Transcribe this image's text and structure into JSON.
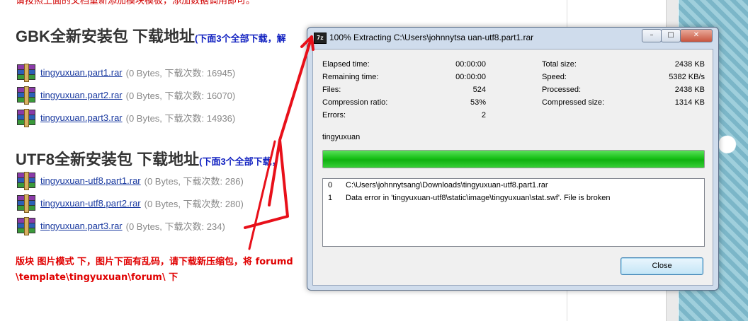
{
  "page": {
    "top_note": "请按照上面的文档重新添加模块模板，添加数据调用即可。",
    "gbk": {
      "title": "GBK全新安装包 下载地址",
      "sub": "(下面3个全部下载，解"
    },
    "gbk_files": [
      {
        "name": "tingyuxuan.part1.rar",
        "meta": "(0 Bytes, 下载次数: 16945)"
      },
      {
        "name": "tingyuxuan.part2.rar",
        "meta": "(0 Bytes, 下载次数: 16070)"
      },
      {
        "name": "tingyuxuan.part3.rar",
        "meta": "(0 Bytes, 下载次数: 14936)"
      }
    ],
    "utf8": {
      "title": "UTF8全新安装包 下载地址",
      "sub": "(下面3个全部下载，"
    },
    "utf8_files": [
      {
        "name": "tingyuxuan-utf8.part1.rar",
        "meta": "(0 Bytes, 下载次数: 286)"
      },
      {
        "name": "tingyuxuan-utf8.part2.rar",
        "meta": "(0 Bytes, 下载次数: 280)"
      },
      {
        "name": "tingyuxuan.part3.rar",
        "meta": "(0 Bytes, 下载次数: 234)"
      }
    ],
    "note_line1": "版块 图片模式 下，图片下面有乱码，请下载新压缩包，将 forumd",
    "note_line2": "\\template\\tingyuxuan\\forum\\ 下"
  },
  "dialog": {
    "app_icon_text": "7z",
    "title": "100% Extracting C:\\Users\\johnnytsa  uan-utf8.part1.rar",
    "window_buttons": [
      "–",
      "□",
      "✕"
    ],
    "stats_left": [
      {
        "label": "Elapsed time:",
        "value": "00:00:00"
      },
      {
        "label": "Remaining time:",
        "value": "00:00:00"
      },
      {
        "label": "Files:",
        "value": "524"
      },
      {
        "label": "Compression ratio:",
        "value": "53%"
      },
      {
        "label": "Errors:",
        "value": "2"
      }
    ],
    "stats_right": [
      {
        "label": "Total size:",
        "value": "2438 KB"
      },
      {
        "label": "Speed:",
        "value": "5382 KB/s"
      },
      {
        "label": "Processed:",
        "value": "2438 KB"
      },
      {
        "label": "Compressed size:",
        "value": "1314 KB"
      }
    ],
    "archive_name": "tingyuxuan",
    "progress_percent": 100,
    "log": [
      {
        "index": "0",
        "message": "C:\\Users\\johnnytsang\\Downloads\\tingyuxuan-utf8.part1.rar"
      },
      {
        "index": "1",
        "message": "Data error in 'tingyuxuan-utf8\\static\\image\\tingyuxuan\\stat.swf'. File is broken"
      }
    ],
    "close_label": "Close"
  },
  "colors": {
    "red_text": "#e00000",
    "link": "#1a3aa0",
    "progress": "#18c018",
    "annotation_arrow": "#e8101a"
  }
}
